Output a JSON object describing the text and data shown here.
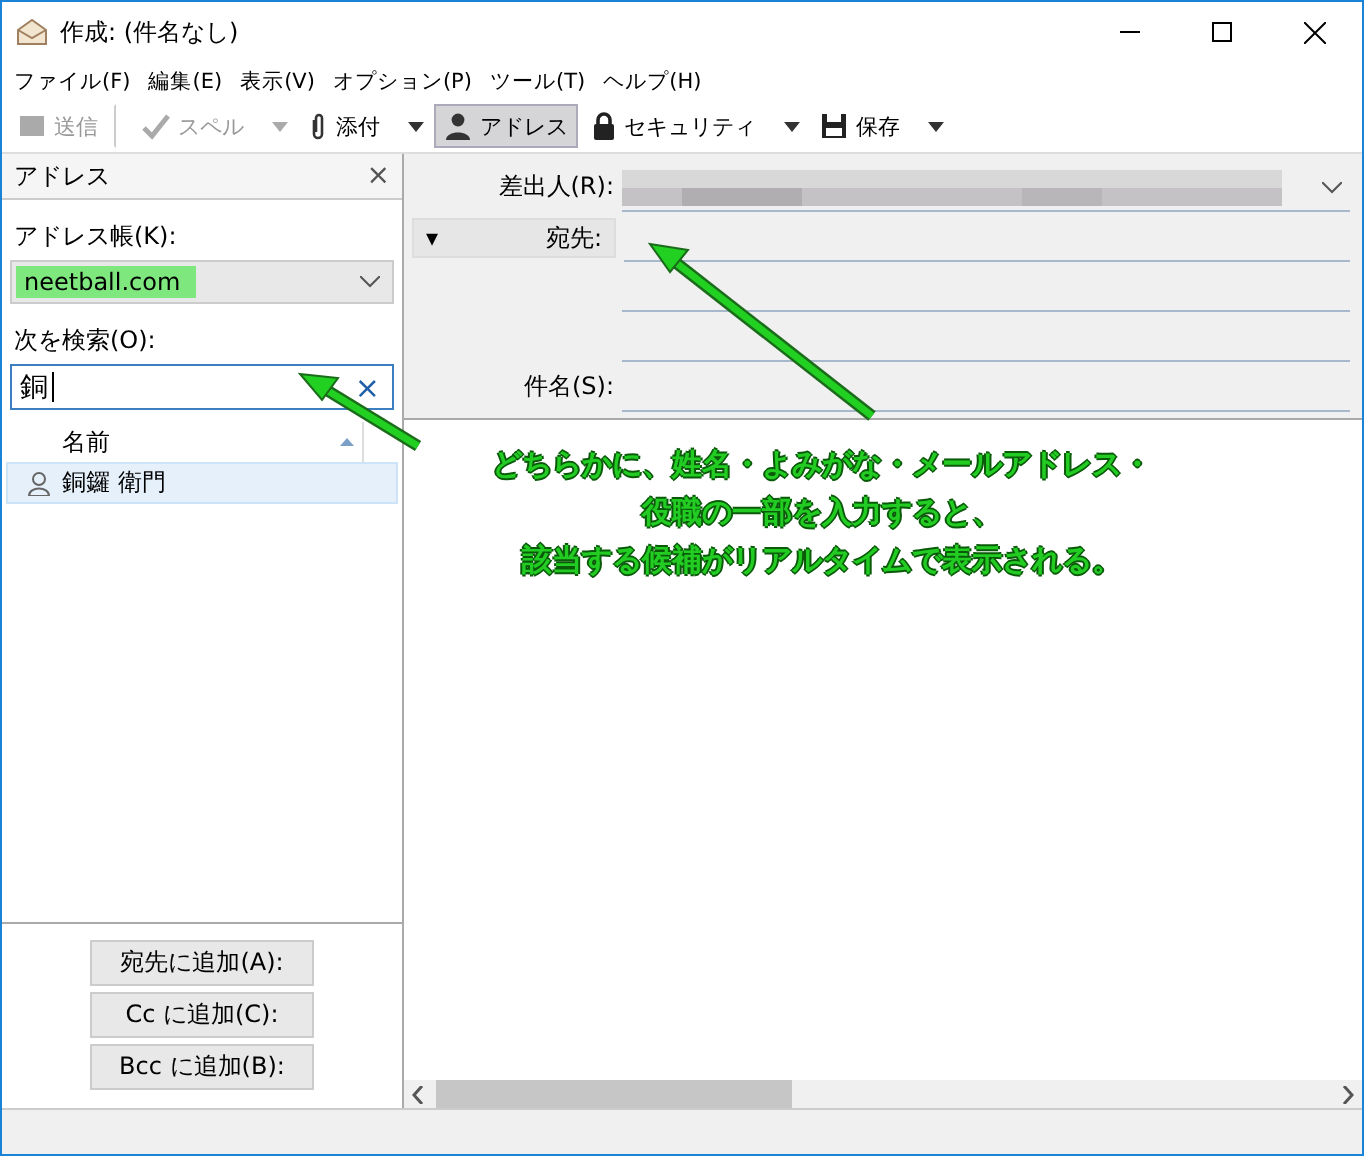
{
  "window": {
    "title": "作成: (件名なし)"
  },
  "menu": [
    "ファイル(F)",
    "編集(E)",
    "表示(V)",
    "オプション(P)",
    "ツール(T)",
    "ヘルプ(H)"
  ],
  "toolbar": [
    {
      "label": "送信",
      "disabled": true,
      "pressed": false,
      "dropdown": false,
      "separator_after": true
    },
    {
      "label": "スペル",
      "disabled": true,
      "pressed": false,
      "dropdown": true,
      "separator_after": false
    },
    {
      "label": "添付",
      "disabled": false,
      "pressed": false,
      "dropdown": true,
      "separator_after": false
    },
    {
      "label": "アドレス",
      "disabled": false,
      "pressed": true,
      "dropdown": false,
      "separator_after": false
    },
    {
      "label": "セキュリティ",
      "disabled": false,
      "pressed": false,
      "dropdown": true,
      "separator_after": false
    },
    {
      "label": "保存",
      "disabled": false,
      "pressed": false,
      "dropdown": true,
      "separator_after": false
    }
  ],
  "sidebar": {
    "title": "アドレス",
    "close": "×",
    "address_book": {
      "label": "アドレス帳(K):",
      "value": "neetball.com",
      "highlighted": true
    },
    "search": {
      "label": "次を検索(O):",
      "value": "銅",
      "clear": "×"
    },
    "column": "名前",
    "contacts": [
      {
        "name": "銅鑼 衛門",
        "selected": true
      }
    ],
    "buttons": [
      "宛先に追加(A):",
      "Cc に追加(C):",
      "Bcc に追加(B):"
    ]
  },
  "compose": {
    "from_label": "差出人(R):",
    "to_label": "宛先:",
    "to_toggle": "▾",
    "subject_label": "件名(S):"
  },
  "annotation": {
    "lines": [
      "どちらかに、姓名・よみがな・メールアドレス・",
      "役職の一部を入力すると、",
      "該当する候補がリアルタイムで表示される。"
    ]
  }
}
